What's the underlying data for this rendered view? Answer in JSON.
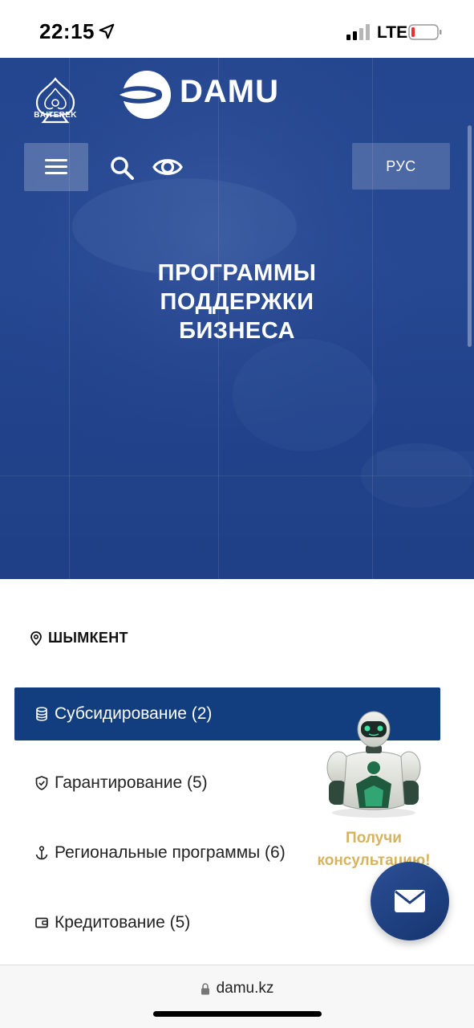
{
  "status_bar": {
    "time": "22:15",
    "network": "LTE",
    "icons": [
      "location-arrow-icon",
      "signal-icon",
      "battery-low-icon"
    ]
  },
  "header": {
    "baiterek_label": "BAITEREK",
    "brand": "DAMU",
    "language_button": "РУС",
    "icons": [
      "menu-icon",
      "search-icon",
      "eye-icon"
    ]
  },
  "hero": {
    "title_line1": "ПРОГРАММЫ",
    "title_line2": "ПОДДЕРЖКИ",
    "title_line3": "БИЗНЕСА"
  },
  "location": {
    "city": "ШЫМКЕНТ",
    "icon": "map-pin-icon"
  },
  "categories": [
    {
      "label": "Субсидирование (2)",
      "icon": "database-icon",
      "active": true
    },
    {
      "label": "Гарантирование (5)",
      "icon": "shield-check-icon",
      "active": false
    },
    {
      "label": "Региональные программы (6)",
      "icon": "anchor-icon",
      "active": false
    },
    {
      "label": "Кредитование (5)",
      "icon": "wallet-icon",
      "active": false
    }
  ],
  "assistant": {
    "cta_line1": "Получи",
    "cta_line2": "консультацию!"
  },
  "browser": {
    "url": "damu.kz"
  },
  "colors": {
    "hero_blue": "#24468f",
    "active_category": "#123e80",
    "cta_gold": "#d6b35e"
  }
}
